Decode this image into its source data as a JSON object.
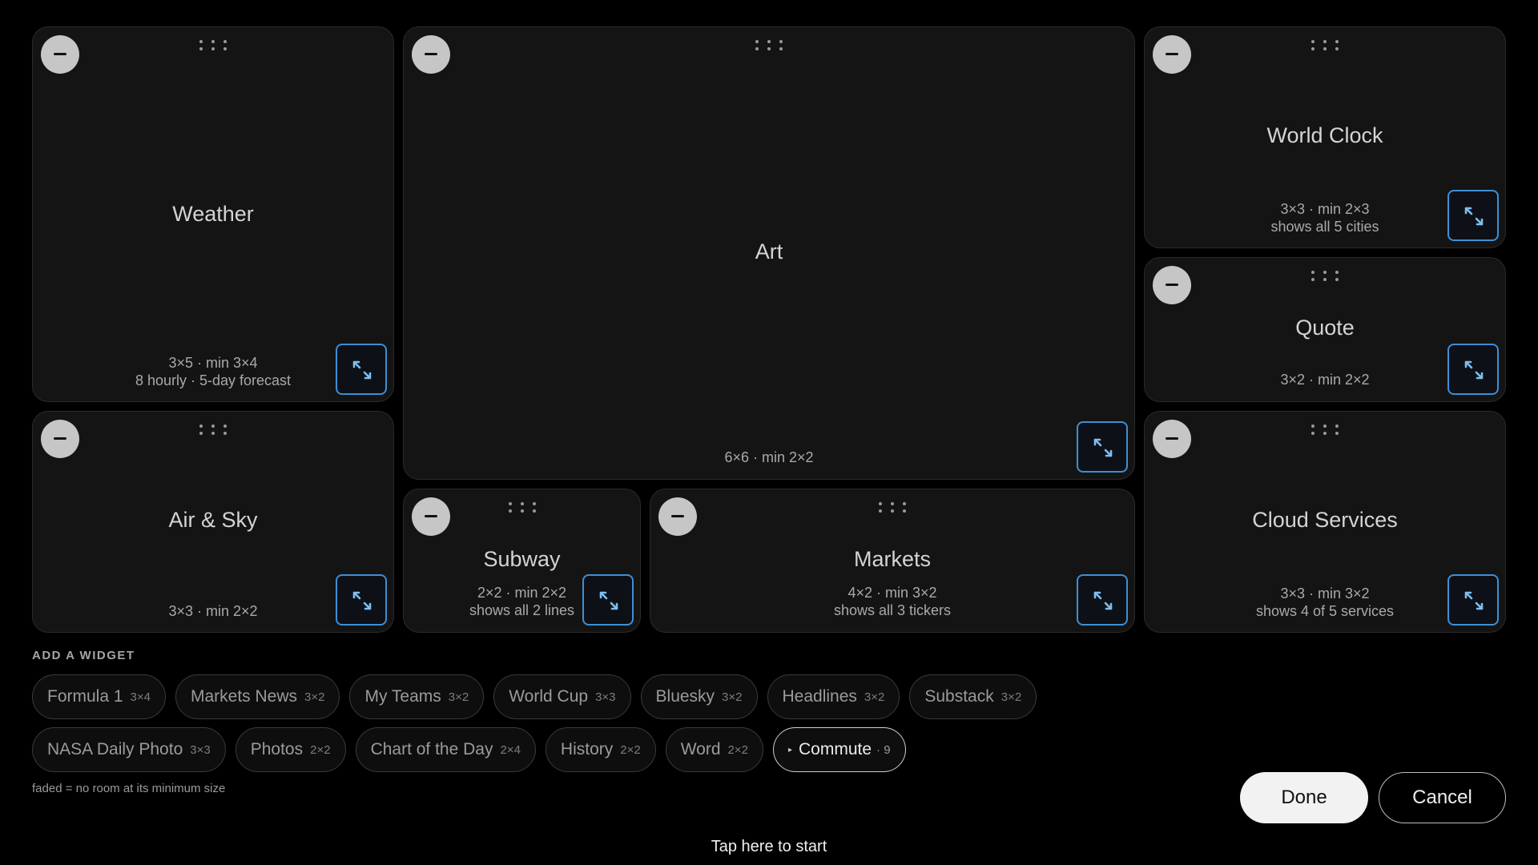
{
  "widgets": {
    "weather": {
      "title": "Weather",
      "meta1": "3×5 · min 3×4",
      "meta2": "8 hourly · 5-day forecast"
    },
    "art": {
      "title": "Art",
      "meta1": "6×6 · min 2×2"
    },
    "world_clock": {
      "title": "World Clock",
      "meta1": "3×3 · min 2×3",
      "meta2": "shows all 5 cities"
    },
    "quote": {
      "title": "Quote",
      "meta1": "3×2 · min 2×2"
    },
    "air_sky": {
      "title": "Air & Sky",
      "meta1": "3×3 · min 2×2"
    },
    "subway": {
      "title": "Subway",
      "meta1": "2×2 · min 2×2",
      "meta2": "shows all 2 lines"
    },
    "markets": {
      "title": "Markets",
      "meta1": "4×2 · min 3×2",
      "meta2": "shows all 3 tickers"
    },
    "cloud_services": {
      "title": "Cloud Services",
      "meta1": "3×3 · min 3×2",
      "meta2": "shows 4 of 5 services"
    }
  },
  "add_widget": {
    "label": "ADD A WIDGET",
    "row1": [
      {
        "name": "Formula 1",
        "size": "3×4"
      },
      {
        "name": "Markets News",
        "size": "3×2"
      },
      {
        "name": "My Teams",
        "size": "3×2"
      },
      {
        "name": "World Cup",
        "size": "3×3"
      },
      {
        "name": "Bluesky",
        "size": "3×2"
      },
      {
        "name": "Headlines",
        "size": "3×2"
      },
      {
        "name": "Substack",
        "size": "3×2"
      }
    ],
    "row2": [
      {
        "name": "NASA Daily Photo",
        "size": "3×3"
      },
      {
        "name": "Photos",
        "size": "2×2"
      },
      {
        "name": "Chart of the Day",
        "size": "2×4"
      },
      {
        "name": "History",
        "size": "2×2"
      },
      {
        "name": "Word",
        "size": "2×2"
      }
    ],
    "commute": {
      "name": "Commute",
      "count": "· 9",
      "icon": "play-triangle-icon"
    },
    "footnote": "faded = no room at its minimum size"
  },
  "actions": {
    "done": "Done",
    "cancel": "Cancel"
  },
  "tap_to_start": "Tap here to start",
  "colors": {
    "background": "#000000",
    "card": "#141414",
    "resize_accent": "#3d8fd6",
    "done_bg": "#f2f2f2"
  }
}
